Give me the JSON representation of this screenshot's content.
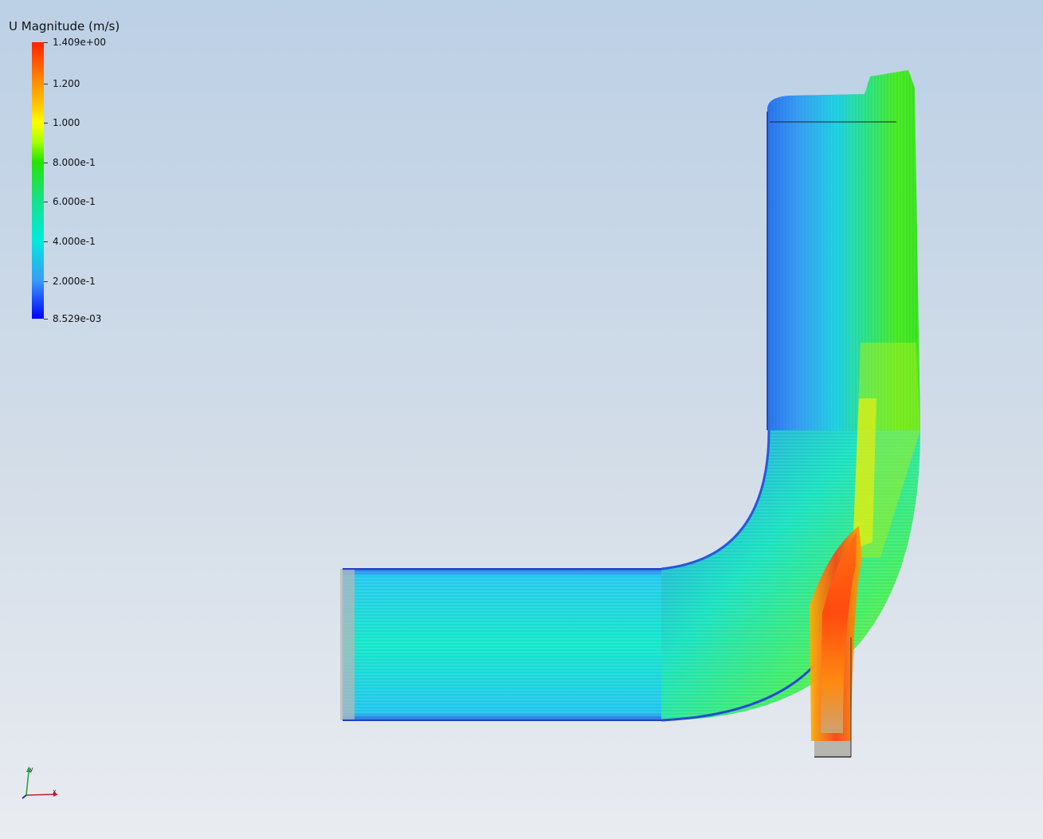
{
  "legend": {
    "title": "U Magnitude (m/s)",
    "ticks": [
      {
        "label": "1.409e+00",
        "value": 1.409
      },
      {
        "label": "1.200",
        "value": 1.2
      },
      {
        "label": "1.000",
        "value": 1.0
      },
      {
        "label": "8.000e-1",
        "value": 0.8
      },
      {
        "label": "6.000e-1",
        "value": 0.6
      },
      {
        "label": "4.000e-1",
        "value": 0.4
      },
      {
        "label": "2.000e-1",
        "value": 0.2
      },
      {
        "label": "8.529e-03",
        "value": 0.008529
      }
    ],
    "min": 0.008529,
    "max": 1.409
  },
  "axes": {
    "x_label": "x",
    "y_label": "y"
  },
  "colors": {
    "low": "#0000ff",
    "mid": "#00e8d0",
    "high": "#ff2200"
  }
}
